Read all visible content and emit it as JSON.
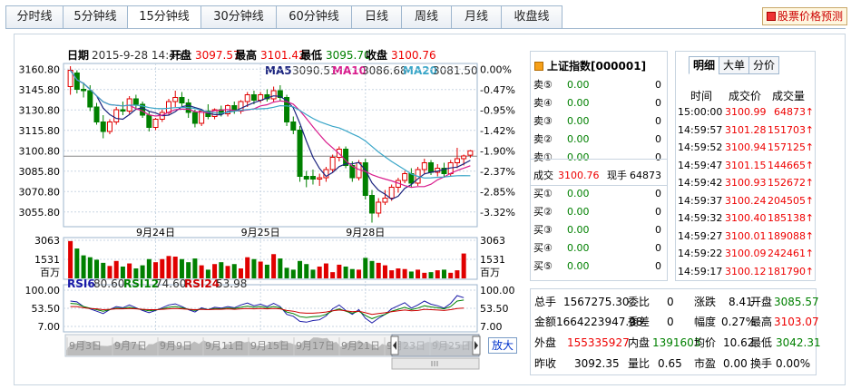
{
  "tabs": [
    {
      "label": "分时线",
      "active": false,
      "w": 64
    },
    {
      "label": "5分钟线",
      "active": false,
      "w": 72
    },
    {
      "label": "15分钟线",
      "active": true,
      "w": 82
    },
    {
      "label": "30分钟线",
      "active": false,
      "w": 84
    },
    {
      "label": "60分钟线",
      "active": false,
      "w": 84
    },
    {
      "label": "日线",
      "active": false,
      "w": 56
    },
    {
      "label": "周线",
      "active": false,
      "w": 56
    },
    {
      "label": "月线",
      "active": false,
      "w": 56
    },
    {
      "label": "收盘线",
      "active": false,
      "w": 68
    }
  ],
  "predict_label": "股票价格预测",
  "header": {
    "date_label": "日期",
    "date_value": "2015-9-28 14:45",
    "open_label": "开盘",
    "open_value": "3097.57",
    "high_label": "最高",
    "high_value": "3101.42",
    "low_label": "最低",
    "low_value": "3095.70",
    "close_label": "收盘",
    "close_value": "3100.76"
  },
  "ma": {
    "ma5_label": "MA5",
    "ma5_value": "3090.51",
    "ma10_label": "MA10",
    "ma10_value": "3086.68",
    "ma20_label": "MA20",
    "ma20_value": "3081.50"
  },
  "colors": {
    "up": "#e00000",
    "down": "#008000",
    "ma5": "#1a237e",
    "ma10": "#d81b8c",
    "ma20": "#3aa6c8",
    "grid": "#c9d6e3"
  },
  "price_axis": [
    "3160.80",
    "3145.80",
    "3130.80",
    "3115.80",
    "3100.80",
    "3085.80",
    "3070.80",
    "3055.80"
  ],
  "pct_axis": [
    "0.00%",
    "-0.47%",
    "-0.95%",
    "-1.42%",
    "-1.90%",
    "-2.37%",
    "-2.85%",
    "-3.32%"
  ],
  "date_labels": [
    "9月24日",
    "9月25日",
    "9月28日"
  ],
  "volume_axis": [
    "3063",
    "1531"
  ],
  "volume_unit": "百万",
  "rsi": {
    "rsi6_label": "RSI6",
    "rsi6_value": "80.60",
    "rsi12_label": "RSI12",
    "rsi12_value": "74.60",
    "rsi24_label": "RSI24",
    "rsi24_value": "53.98",
    "axis": [
      "100.00",
      "53.50",
      "7.00"
    ]
  },
  "timeline_labels": [
    "9月3日",
    "9月7日",
    "9月9日",
    "9月11日",
    "9月15日",
    "9月17日",
    "9月21日",
    "9月23日",
    "9月25日"
  ],
  "enlarge_label": "放大",
  "chart_data": [
    {
      "type": "candlestick",
      "ylim": [
        3047.0,
        3163.0
      ],
      "date_labels": [
        "9月24日",
        "9月25日",
        "9月28日"
      ],
      "candles": [
        {
          "o": 3148,
          "h": 3163,
          "l": 3142,
          "c": 3160
        },
        {
          "o": 3158,
          "h": 3160,
          "l": 3143,
          "c": 3146
        },
        {
          "o": 3146,
          "h": 3151,
          "l": 3140,
          "c": 3145
        },
        {
          "o": 3145,
          "h": 3149,
          "l": 3130,
          "c": 3133
        },
        {
          "o": 3133,
          "h": 3136,
          "l": 3120,
          "c": 3122
        },
        {
          "o": 3122,
          "h": 3127,
          "l": 3110,
          "c": 3115
        },
        {
          "o": 3115,
          "h": 3124,
          "l": 3113,
          "c": 3122
        },
        {
          "o": 3122,
          "h": 3133,
          "l": 3120,
          "c": 3131
        },
        {
          "o": 3131,
          "h": 3137,
          "l": 3127,
          "c": 3130
        },
        {
          "o": 3130,
          "h": 3141,
          "l": 3128,
          "c": 3139
        },
        {
          "o": 3139,
          "h": 3142,
          "l": 3132,
          "c": 3135
        },
        {
          "o": 3135,
          "h": 3137,
          "l": 3125,
          "c": 3127
        },
        {
          "o": 3127,
          "h": 3130,
          "l": 3115,
          "c": 3118
        },
        {
          "o": 3118,
          "h": 3125,
          "l": 3116,
          "c": 3124
        },
        {
          "o": 3124,
          "h": 3131,
          "l": 3122,
          "c": 3129
        },
        {
          "o": 3129,
          "h": 3139,
          "l": 3127,
          "c": 3137
        },
        {
          "o": 3137,
          "h": 3145,
          "l": 3133,
          "c": 3140
        },
        {
          "o": 3140,
          "h": 3144,
          "l": 3133,
          "c": 3136
        },
        {
          "o": 3136,
          "h": 3139,
          "l": 3125,
          "c": 3129
        },
        {
          "o": 3129,
          "h": 3131,
          "l": 3118,
          "c": 3121
        },
        {
          "o": 3121,
          "h": 3131,
          "l": 3119,
          "c": 3130
        },
        {
          "o": 3130,
          "h": 3135,
          "l": 3124,
          "c": 3126
        },
        {
          "o": 3126,
          "h": 3132,
          "l": 3124,
          "c": 3131
        },
        {
          "o": 3131,
          "h": 3134,
          "l": 3126,
          "c": 3128
        },
        {
          "o": 3128,
          "h": 3135,
          "l": 3126,
          "c": 3134
        },
        {
          "o": 3134,
          "h": 3137,
          "l": 3128,
          "c": 3130
        },
        {
          "o": 3130,
          "h": 3138,
          "l": 3128,
          "c": 3137
        },
        {
          "o": 3137,
          "h": 3144,
          "l": 3133,
          "c": 3142
        },
        {
          "o": 3142,
          "h": 3145,
          "l": 3135,
          "c": 3138
        },
        {
          "o": 3138,
          "h": 3144,
          "l": 3136,
          "c": 3142
        },
        {
          "o": 3142,
          "h": 3146,
          "l": 3137,
          "c": 3139
        },
        {
          "o": 3139,
          "h": 3148,
          "l": 3137,
          "c": 3145
        },
        {
          "o": 3145,
          "h": 3149,
          "l": 3137,
          "c": 3140
        },
        {
          "o": 3140,
          "h": 3142,
          "l": 3119,
          "c": 3122
        },
        {
          "o": 3122,
          "h": 3126,
          "l": 3113,
          "c": 3116
        },
        {
          "o": 3116,
          "h": 3119,
          "l": 3078,
          "c": 3082
        },
        {
          "o": 3082,
          "h": 3086,
          "l": 3074,
          "c": 3080
        },
        {
          "o": 3082,
          "h": 3087,
          "l": 3076,
          "c": 3080
        },
        {
          "o": 3080,
          "h": 3084,
          "l": 3075,
          "c": 3081
        },
        {
          "o": 3081,
          "h": 3089,
          "l": 3078,
          "c": 3087
        },
        {
          "o": 3087,
          "h": 3098,
          "l": 3085,
          "c": 3096
        },
        {
          "o": 3096,
          "h": 3104,
          "l": 3093,
          "c": 3102
        },
        {
          "o": 3102,
          "h": 3104,
          "l": 3088,
          "c": 3090
        },
        {
          "o": 3090,
          "h": 3093,
          "l": 3078,
          "c": 3081
        },
        {
          "o": 3081,
          "h": 3094,
          "l": 3079,
          "c": 3092
        },
        {
          "o": 3092,
          "h": 3095,
          "l": 3065,
          "c": 3068
        },
        {
          "o": 3068,
          "h": 3072,
          "l": 3048,
          "c": 3055
        },
        {
          "o": 3055,
          "h": 3066,
          "l": 3052,
          "c": 3063
        },
        {
          "o": 3063,
          "h": 3072,
          "l": 3061,
          "c": 3066
        },
        {
          "o": 3066,
          "h": 3076,
          "l": 3064,
          "c": 3074
        },
        {
          "o": 3074,
          "h": 3081,
          "l": 3070,
          "c": 3079
        },
        {
          "o": 3079,
          "h": 3086,
          "l": 3077,
          "c": 3084
        },
        {
          "o": 3084,
          "h": 3088,
          "l": 3074,
          "c": 3077
        },
        {
          "o": 3077,
          "h": 3089,
          "l": 3075,
          "c": 3087
        },
        {
          "o": 3087,
          "h": 3095,
          "l": 3084,
          "c": 3092
        },
        {
          "o": 3092,
          "h": 3094,
          "l": 3083,
          "c": 3085
        },
        {
          "o": 3085,
          "h": 3091,
          "l": 3082,
          "c": 3088
        },
        {
          "o": 3088,
          "h": 3092,
          "l": 3081,
          "c": 3084
        },
        {
          "o": 3084,
          "h": 3094,
          "l": 3082,
          "c": 3092
        },
        {
          "o": 3092,
          "h": 3103,
          "l": 3088,
          "c": 3095
        },
        {
          "o": 3095,
          "h": 3098,
          "l": 3090,
          "c": 3097
        },
        {
          "o": 3097.57,
          "h": 3101.42,
          "l": 3095.7,
          "c": 3100.76
        }
      ]
    },
    {
      "type": "bar",
      "ylim": [
        0,
        3063
      ],
      "values": [
        3000,
        2400,
        1850,
        1700,
        1500,
        1250,
        1000,
        1400,
        950,
        1200,
        800,
        1050,
        1550,
        1300,
        1550,
        1800,
        1750,
        1550,
        1300,
        1600,
        1050,
        700,
        1150,
        1300,
        1000,
        1150,
        800,
        1700,
        1550,
        1350,
        1100,
        1950,
        1600,
        850,
        700,
        1400,
        1150,
        700,
        950,
        1200,
        500,
        1100,
        950,
        750,
        700,
        1650,
        1400,
        1250,
        1050,
        650,
        800,
        750,
        550,
        700,
        450,
        500,
        650,
        700,
        450,
        650,
        2000
      ]
    },
    {
      "type": "line",
      "ylim": [
        7.0,
        100.0
      ],
      "series": [
        {
          "name": "RSI6",
          "values": [
            72,
            70,
            58,
            52,
            46,
            40,
            50,
            58,
            55,
            62,
            55,
            48,
            42,
            48,
            55,
            62,
            65,
            58,
            50,
            44,
            55,
            50,
            56,
            54,
            58,
            55,
            62,
            67,
            60,
            64,
            58,
            66,
            58,
            38,
            33,
            20,
            18,
            22,
            24,
            34,
            52,
            62,
            48,
            38,
            50,
            28,
            16,
            28,
            38,
            52,
            60,
            68,
            54,
            62,
            72,
            64,
            60,
            54,
            66,
            86,
            80.6
          ]
        },
        {
          "name": "RSI12",
          "values": [
            66,
            65,
            58,
            54,
            50,
            46,
            50,
            54,
            53,
            56,
            53,
            50,
            47,
            49,
            52,
            56,
            58,
            55,
            51,
            48,
            52,
            50,
            53,
            52,
            54,
            53,
            56,
            59,
            56,
            58,
            55,
            58,
            55,
            44,
            40,
            32,
            30,
            32,
            33,
            38,
            47,
            52,
            46,
            41,
            46,
            35,
            27,
            33,
            38,
            46,
            51,
            56,
            50,
            54,
            60,
            57,
            55,
            52,
            58,
            72,
            74.6
          ]
        },
        {
          "name": "RSI24",
          "values": [
            58,
            58,
            55,
            53,
            52,
            50,
            51,
            52,
            52,
            53,
            52,
            51,
            50,
            50,
            51,
            52,
            53,
            52,
            51,
            50,
            51,
            50,
            51,
            51,
            52,
            51,
            52,
            53,
            52,
            53,
            52,
            53,
            52,
            48,
            46,
            42,
            41,
            41,
            42,
            44,
            47,
            49,
            47,
            45,
            46,
            42,
            38,
            40,
            42,
            45,
            47,
            49,
            47,
            48,
            51,
            50,
            49,
            48,
            50,
            53,
            53.98
          ]
        }
      ]
    }
  ],
  "quote": {
    "title": "上证指数[000001]",
    "sell": [
      {
        "label": "卖⑤",
        "price": "0.00",
        "vol": "0"
      },
      {
        "label": "卖④",
        "price": "0.00",
        "vol": "0"
      },
      {
        "label": "卖③",
        "price": "0.00",
        "vol": "0"
      },
      {
        "label": "卖②",
        "price": "0.00",
        "vol": "0"
      },
      {
        "label": "卖①",
        "price": "0.00",
        "vol": "0"
      }
    ],
    "deal_label": "成交",
    "deal_price": "3100.76",
    "hand_label": "现手",
    "hand_value": "64873",
    "buy": [
      {
        "label": "买①",
        "price": "0.00",
        "vol": "0"
      },
      {
        "label": "买②",
        "price": "0.00",
        "vol": "0"
      },
      {
        "label": "买③",
        "price": "0.00",
        "vol": "0"
      },
      {
        "label": "买④",
        "price": "0.00",
        "vol": "0"
      },
      {
        "label": "买⑤",
        "price": "0.00",
        "vol": "0"
      }
    ]
  },
  "detail": {
    "tabs": [
      "明细",
      "大单",
      "分价"
    ],
    "head_time": "时间",
    "head_price": "成交价",
    "head_vol": "成交量",
    "rows": [
      {
        "time": "15:00:00",
        "price": "3100.99",
        "vol": "64873",
        "arrow": "↑"
      },
      {
        "time": "14:59:57",
        "price": "3101.28",
        "vol": "151703",
        "arrow": "↑"
      },
      {
        "time": "14:59:52",
        "price": "3100.94",
        "vol": "157125",
        "arrow": "↑"
      },
      {
        "time": "14:59:47",
        "price": "3101.15",
        "vol": "144665",
        "arrow": "↑"
      },
      {
        "time": "14:59:42",
        "price": "3100.93",
        "vol": "152672",
        "arrow": "↑"
      },
      {
        "time": "14:59:37",
        "price": "3100.24",
        "vol": "204505",
        "arrow": "↑"
      },
      {
        "time": "14:59:32",
        "price": "3100.40",
        "vol": "185138",
        "arrow": "↑"
      },
      {
        "time": "14:59:27",
        "price": "3100.01",
        "vol": "189088",
        "arrow": "↑"
      },
      {
        "time": "14:59:22",
        "price": "3100.09",
        "vol": "242461",
        "arrow": "↑"
      },
      {
        "time": "14:59:17",
        "price": "3100.12",
        "vol": "181790",
        "arrow": "↑"
      }
    ]
  },
  "stats": {
    "r1": {
      "l1": "总手",
      "v1": "1567275.30",
      "l2": "委比",
      "v2": "0",
      "l3": "涨跌",
      "v3": "8.41",
      "l4": "开盘",
      "v4": "3085.57"
    },
    "r2": {
      "l1": "金额",
      "v1": "1664223947.98",
      "l2": "委差",
      "v2": "0",
      "l3": "幅度",
      "v3": "0.27%",
      "l4": "最高",
      "v4": "3103.07"
    },
    "r3": {
      "l1": "外盘",
      "v1": "155335927",
      "l2": "内盘",
      "v2": "1391603",
      "l3": "均价",
      "v3": "10.62",
      "l4": "最低",
      "v4": "3042.31"
    },
    "r4": {
      "l1": "昨收",
      "v1": "3092.35",
      "l2": "量比",
      "v2": "0.65",
      "l3": "市盈",
      "v3": "0.00",
      "l4": "换手",
      "v4": "0.00%"
    }
  }
}
